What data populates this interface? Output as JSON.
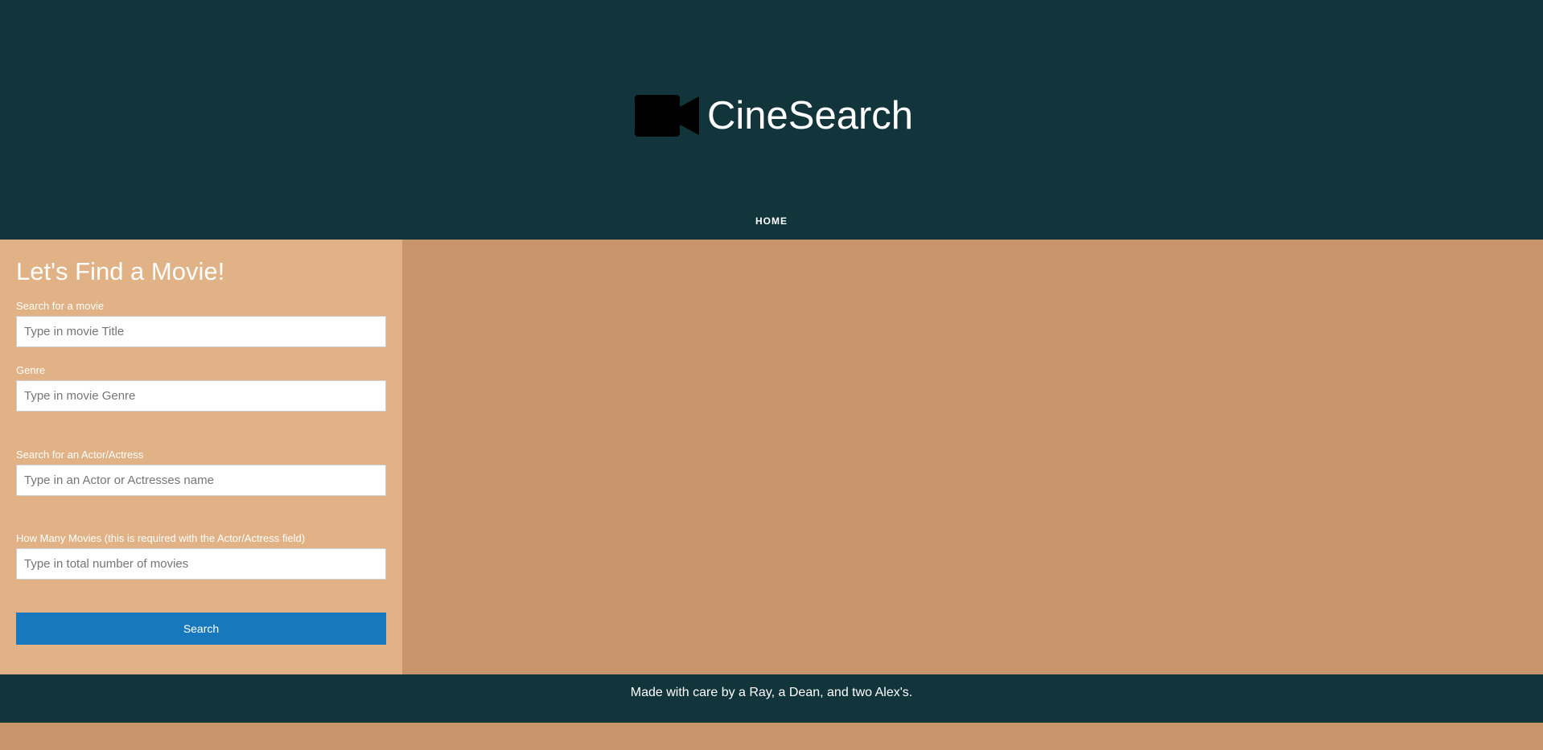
{
  "header": {
    "brand_icon": "video-camera-icon",
    "title": "CineSearch",
    "nav": [
      {
        "label": "HOME"
      }
    ]
  },
  "sidebar": {
    "title": "Let's Find a Movie!",
    "fields": {
      "title": {
        "label": "Search for a movie",
        "placeholder": "Type in movie Title",
        "value": ""
      },
      "genre": {
        "label": "Genre",
        "placeholder": "Type in movie Genre",
        "value": ""
      },
      "actor": {
        "label": "Search for an Actor/Actress",
        "placeholder": "Type in an Actor or Actresses name",
        "value": ""
      },
      "count": {
        "label": "How Many Movies (this is required with the Actor/Actress field)",
        "placeholder": "Type in total number of movies",
        "value": ""
      }
    },
    "search_label": "Search"
  },
  "footer": {
    "text": "Made with care by a Ray, a Dean, and two Alex's."
  },
  "colors": {
    "header_bg": "#12343b",
    "sidebar_bg": "#e0b285",
    "main_bg": "#c8956a",
    "button_bg": "#1778bd",
    "text_light": "#ffffff"
  }
}
